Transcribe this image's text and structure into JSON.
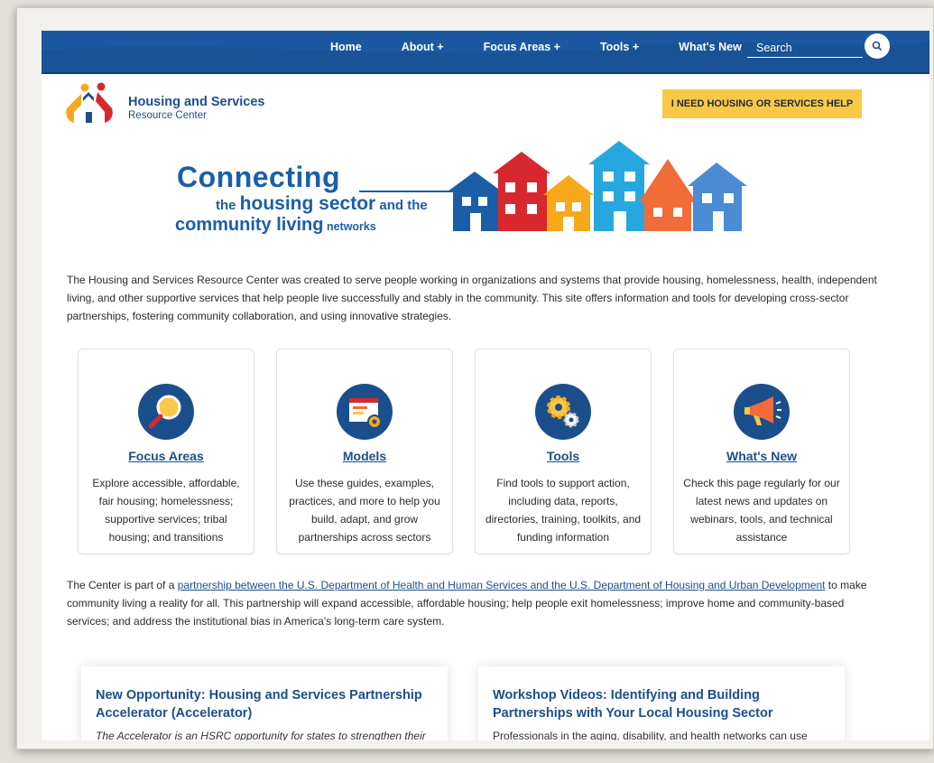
{
  "nav": {
    "items": [
      "Home",
      "About +",
      "Focus Areas +",
      "Tools +",
      "What's New"
    ],
    "search_placeholder": "Search"
  },
  "header": {
    "org_name": "Housing and Services",
    "org_sub": "Resource Center",
    "help_button": "I NEED HOUSING OR SERVICES HELP"
  },
  "banner": {
    "line1": "Connecting",
    "line2a": "the ",
    "line2b": "housing sector",
    "line2c": " and the",
    "line3a": "community living",
    "line3b": " networks"
  },
  "intro": "The Housing and Services Resource Center was created to serve people working in organizations and systems that provide housing, homelessness, health, independent living, and other supportive services that help people live successfully and stably in the community. This site offers information and tools for developing cross-sector partnerships, fostering community collaboration, and using innovative strategies.",
  "cards": [
    {
      "title": "Focus Areas",
      "desc": "Explore accessible, affordable, fair housing; homelessness; supportive services; tribal housing; and transitions",
      "icon": "magnifier-icon"
    },
    {
      "title": "Models",
      "desc": "Use these guides, examples, practices, and more to help you build, adapt, and grow partnerships across sectors",
      "icon": "browser-gear-icon"
    },
    {
      "title": "Tools",
      "desc": "Find tools to support action, including data, reports, directories, training, toolkits, and funding information",
      "icon": "gears-icon"
    },
    {
      "title": "What's New",
      "desc": "Check this page regularly for our latest news and updates on webinars, tools, and technical assistance",
      "icon": "megaphone-icon"
    }
  ],
  "partnership": {
    "pre": "The Center is part of a ",
    "link": "partnership between the U.S. Department of Health and Human Services and the U.S. Department of Housing and Urban Development",
    "post": " to make community living a reality for all. This partnership will expand accessible, affordable housing; help people exit homelessness; improve home and community-based services; and address the institutional bias in America's long-term care system."
  },
  "news": [
    {
      "title": "New Opportunity: Housing and Services Partnership Accelerator (Accelerator)",
      "desc": "The Accelerator is an HSRC opportunity for states to strengthen their"
    },
    {
      "title": "Workshop Videos: Identifying and Building Partnerships with Your Local Housing Sector",
      "desc": "Professionals in the aging, disability, and health networks can use"
    }
  ],
  "colors": {
    "nav": "#1f5ea8",
    "brand": "#1b4f8c",
    "help": "#f9c846"
  }
}
